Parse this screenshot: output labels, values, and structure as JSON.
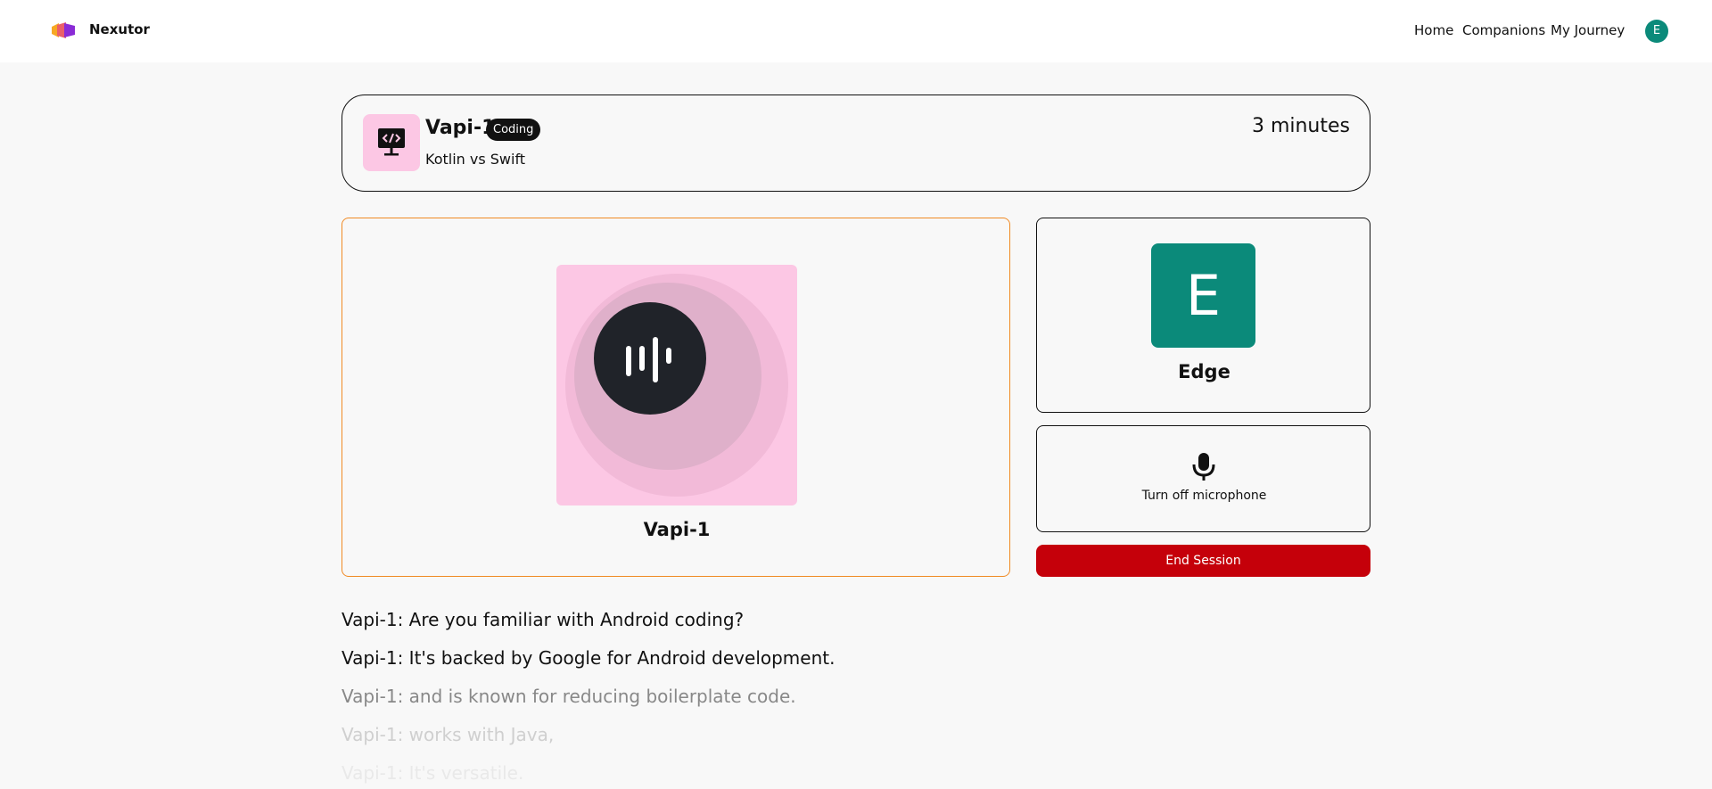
{
  "navbar": {
    "brand": "Nexutor",
    "links": [
      "Home",
      "Companions",
      "My Journey"
    ],
    "avatar_initial": "E",
    "avatar_color": "#0b8a7a"
  },
  "session_header": {
    "companion_name": "Vapi-1",
    "subject": "Coding",
    "topic": "Kotlin vs Swift",
    "duration": "3 minutes",
    "subject_color": "#fcc7e4",
    "subject_icon": "code-monitor-icon"
  },
  "companion": {
    "name": "Vapi-1",
    "icon": "soundwave-icon"
  },
  "user": {
    "initial": "E",
    "name": "Edge"
  },
  "controls": {
    "mic_label": "Turn off microphone",
    "mic_icon": "microphone-icon",
    "end_label": "End Session",
    "end_color": "#c5000a"
  },
  "transcript": [
    "Vapi-1: Are you familiar with Android coding?",
    "Vapi-1: It's backed by Google for Android development.",
    "Vapi-1: and is known for reducing boilerplate code.",
    "Vapi-1: works with Java,",
    "Vapi-1: It's versatile."
  ]
}
